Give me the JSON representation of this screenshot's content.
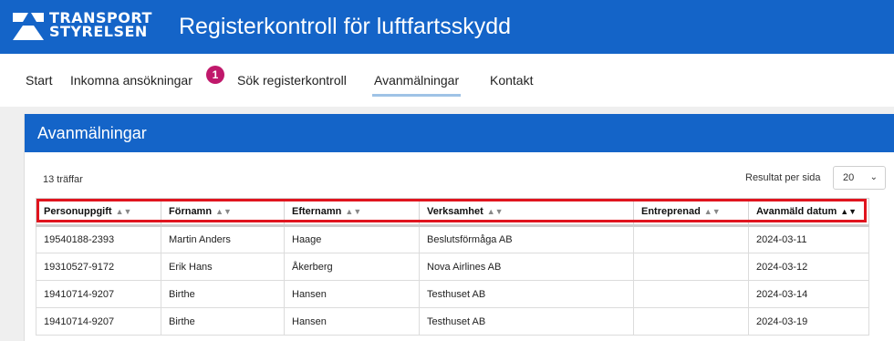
{
  "brand": {
    "line1": "TRANSPORT",
    "line2": "STYRELSEN"
  },
  "app_title": "Registerkontroll för luftfartsskydd",
  "nav": {
    "items": [
      {
        "label": "Start"
      },
      {
        "label": "Inkomna ansökningar",
        "badge": "1"
      },
      {
        "label": "Sök registerkontroll"
      },
      {
        "label": "Avanmälningar",
        "active": true
      },
      {
        "label": "Kontakt"
      }
    ]
  },
  "panel": {
    "title": "Avanmälningar"
  },
  "results": {
    "hits": "13 träffar",
    "per_page_label": "Resultat per sida",
    "per_page_value": "20"
  },
  "table": {
    "columns": [
      "Personuppgift",
      "Förnamn",
      "Efternamn",
      "Verksamhet",
      "Entreprenad",
      "Avanmäld datum"
    ],
    "rows": [
      [
        "19540188-2393",
        "Martin Anders",
        "Haage",
        "Beslutsförmåga AB",
        "",
        "2024-03-11"
      ],
      [
        "19310527-9172",
        "Erik Hans",
        "Åkerberg",
        "Nova Airlines AB",
        "",
        "2024-03-12"
      ],
      [
        "19410714-9207",
        "Birthe",
        "Hansen",
        "Testhuset AB",
        "",
        "2024-03-14"
      ],
      [
        "19410714-9207",
        "Birthe",
        "Hansen",
        "Testhuset AB",
        "",
        "2024-03-19"
      ]
    ]
  },
  "colors": {
    "brand_blue": "#1464c8",
    "badge": "#c0186b",
    "highlight": "#e0141e"
  }
}
